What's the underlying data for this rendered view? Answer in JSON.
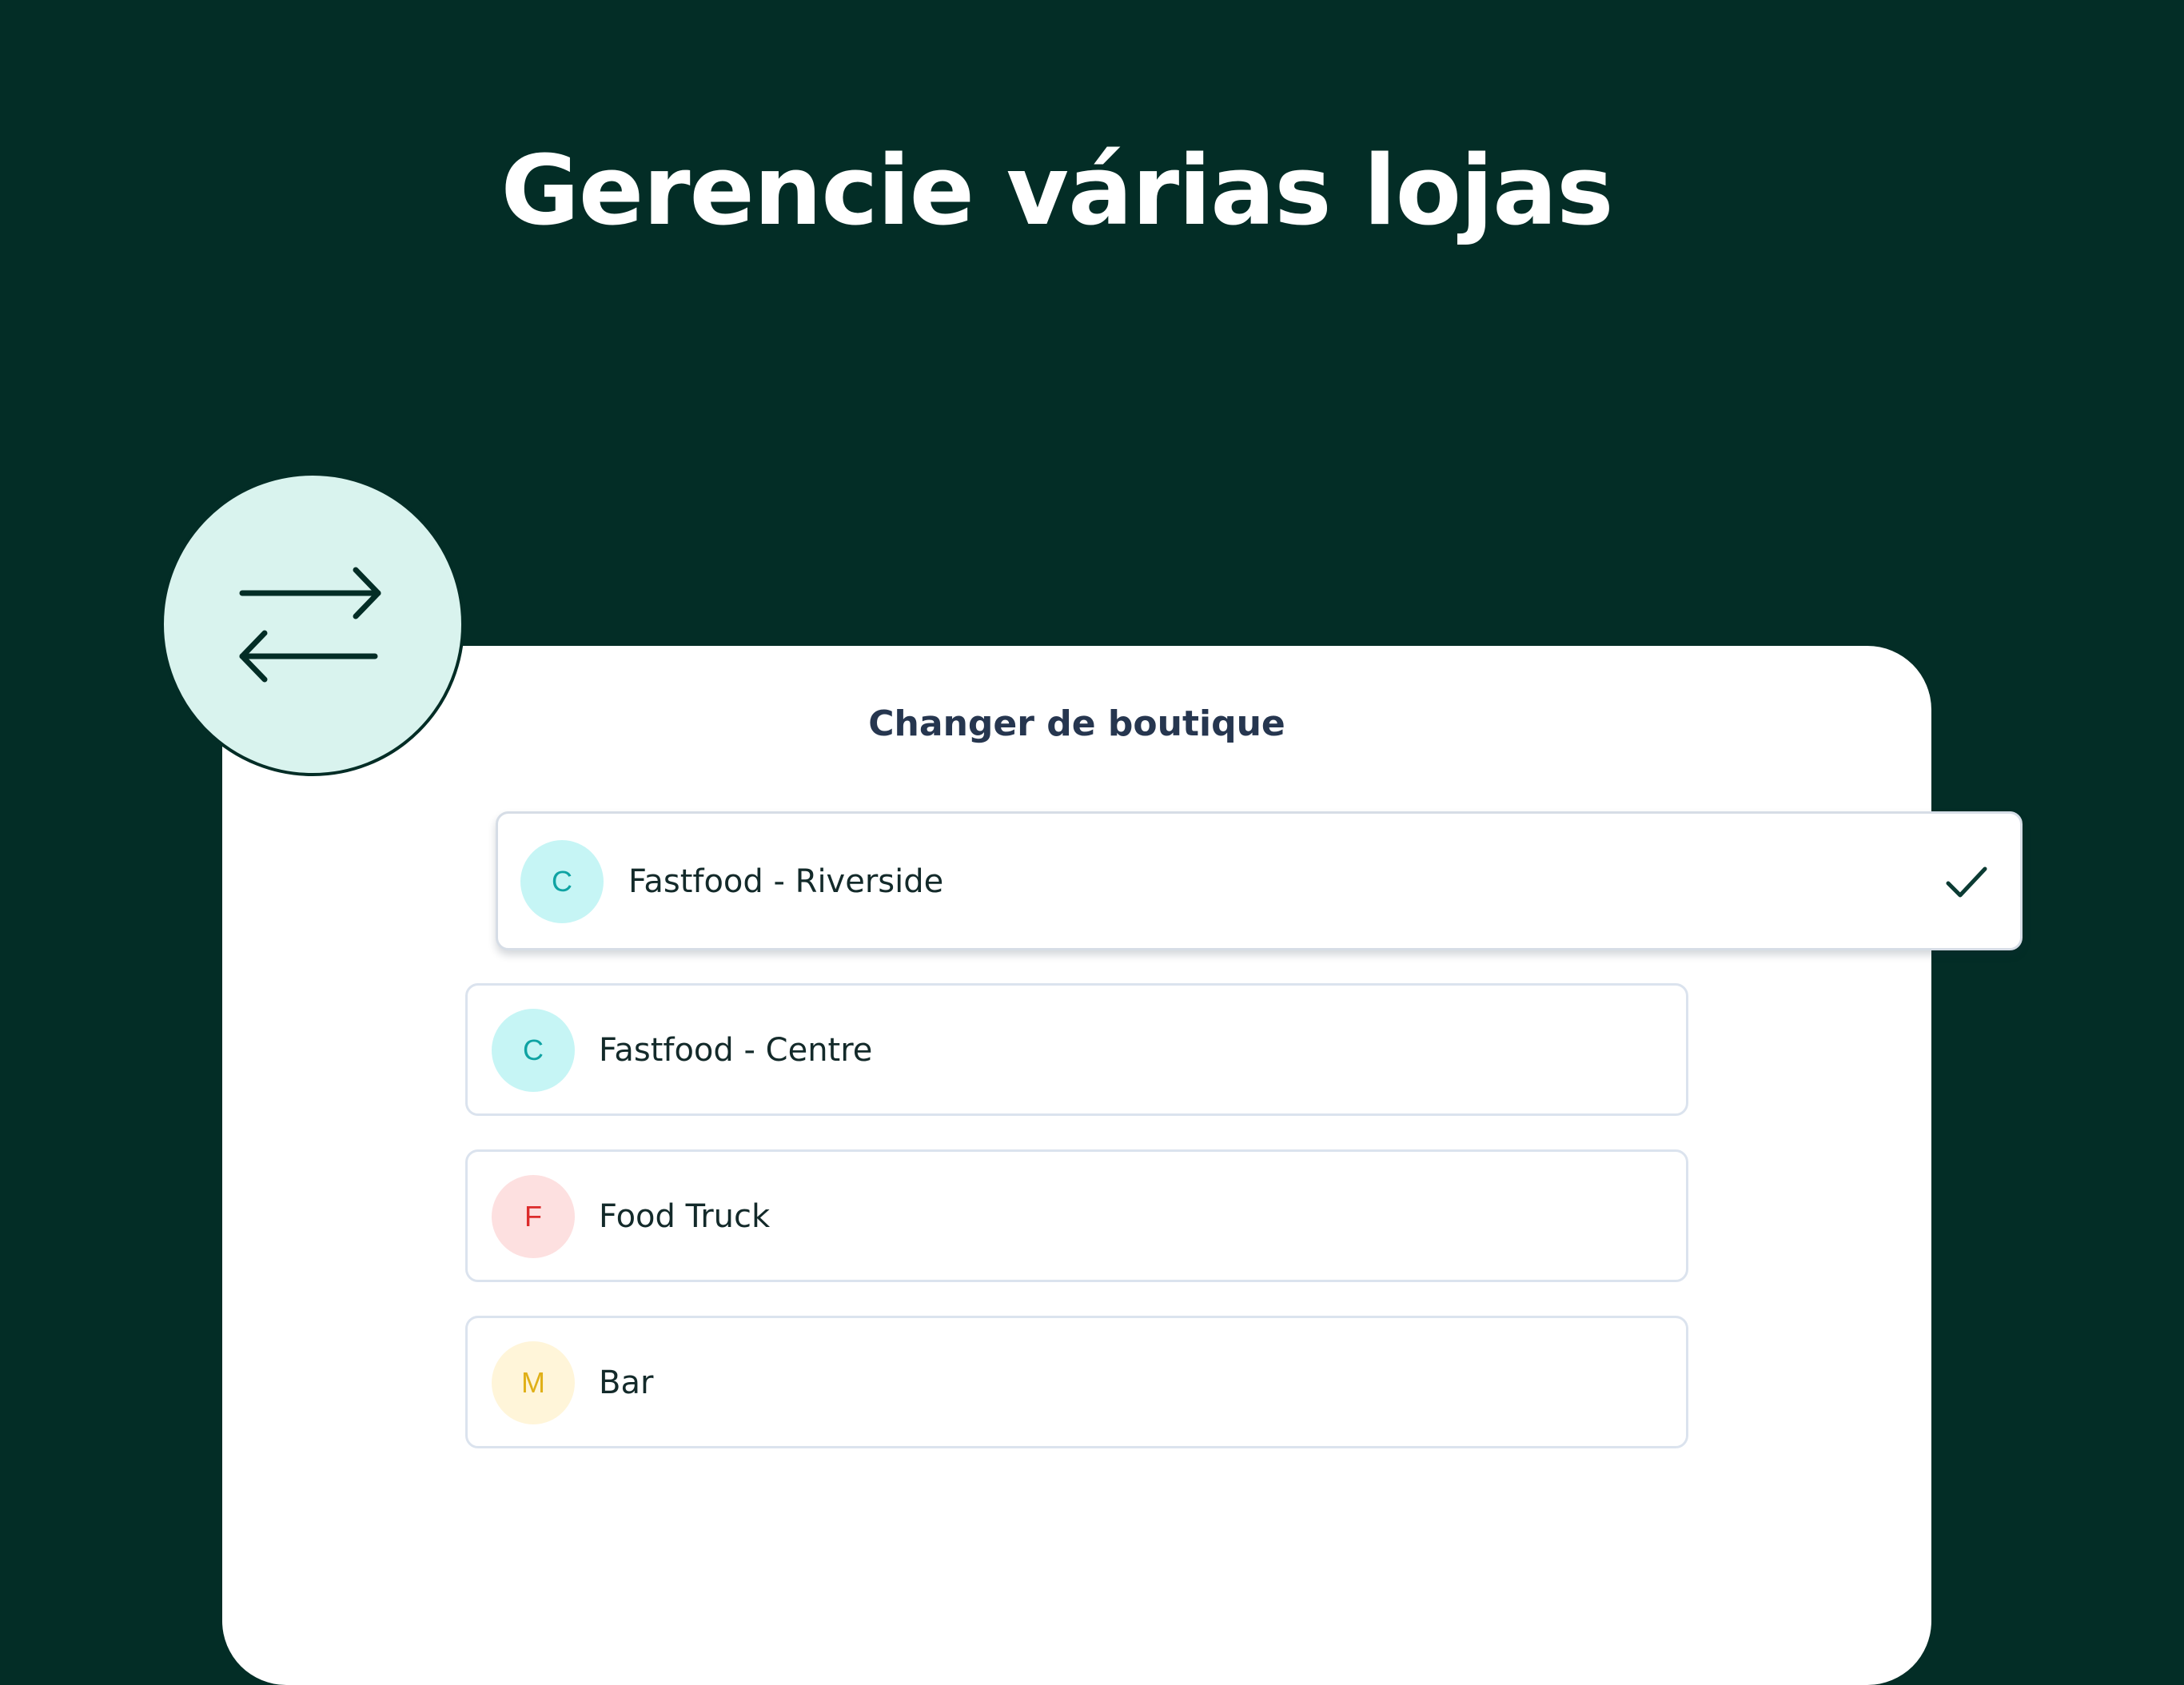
{
  "headline": "Gerencie várias lojas",
  "dialog": {
    "title": "Changer de boutique",
    "stores": [
      {
        "name": "Fastfood - Riverside",
        "initial": "C",
        "avatar_bg": "#c6f5f5",
        "avatar_fg": "#0fa3a3",
        "selected": true
      },
      {
        "name": "Fastfood - Centre",
        "initial": "C",
        "avatar_bg": "#c6f5f5",
        "avatar_fg": "#0fa3a3",
        "selected": false
      },
      {
        "name": "Food Truck",
        "initial": "F",
        "avatar_bg": "#fde0e0",
        "avatar_fg": "#dc2c2c",
        "selected": false
      },
      {
        "name": "Bar",
        "initial": "M",
        "avatar_bg": "#fff5d9",
        "avatar_fg": "#e0b018",
        "selected": false
      }
    ]
  },
  "icons": {
    "switch": "arrows-left-right-icon",
    "selected_marker": "check-icon"
  },
  "colors": {
    "background": "#032d26",
    "card": "#ffffff",
    "badge_bg": "#d9f3ee",
    "check": "#0b3b33"
  }
}
